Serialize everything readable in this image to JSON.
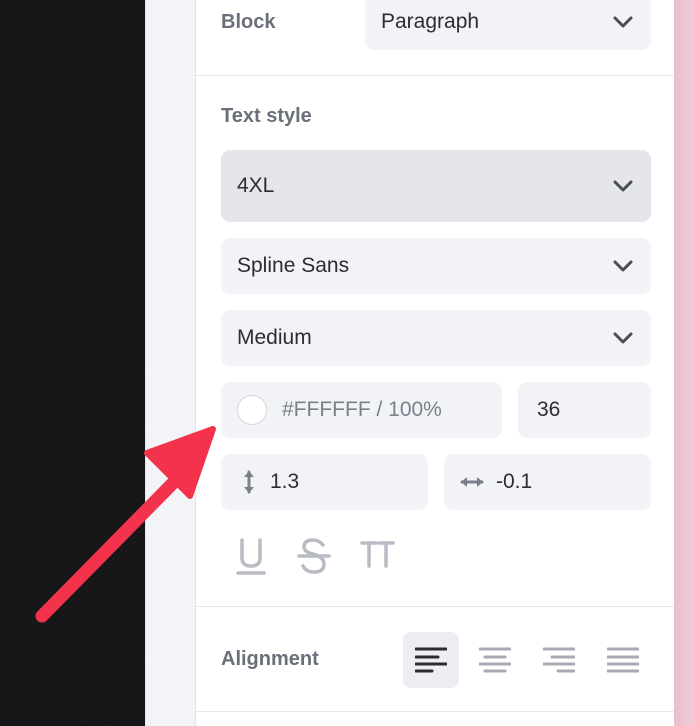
{
  "block": {
    "label": "Block",
    "value": "Paragraph"
  },
  "text_style": {
    "label": "Text style",
    "size": "4XL",
    "font": "Spline Sans",
    "weight": "Medium",
    "color_value": "#FFFFFF / 100%",
    "font_size": "36",
    "line_height": "1.3",
    "letter_spacing": "-0.1"
  },
  "alignment": {
    "label": "Alignment",
    "selected": "left"
  },
  "icons": {
    "underline": "underline-icon",
    "strikethrough": "strikethrough-icon",
    "uppercase": "uppercase-icon",
    "line_height": "vertical-arrows-icon",
    "letter_spacing": "horizontal-arrows-icon"
  },
  "colors": {
    "arrow": "#F2334B",
    "panel_bg": "#FFFFFF",
    "field_bg": "#F2F3F7"
  }
}
